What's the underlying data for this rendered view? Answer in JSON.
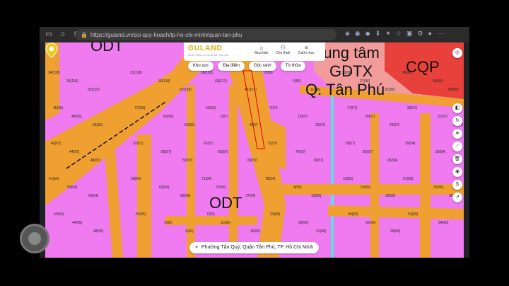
{
  "browser": {
    "url": "https://guland.vn/soi-quy-hoach/tp-ho-chi-minh/quan-tan-phu"
  },
  "header": {
    "logo": "GULAND",
    "logo_sub": "Kênh thông tin mua bán nhà đất",
    "nav": [
      {
        "icon": "house-icon",
        "label": "Mua bán"
      },
      {
        "icon": "people-icon",
        "label": "Cho thuê"
      },
      {
        "icon": "menu-icon",
        "label": "Danh mục"
      }
    ]
  },
  "chips": [
    "Khu vực",
    "Địa điểm",
    "Góc ranh",
    "Tờ thửa"
  ],
  "map_labels": {
    "odt_top": "ODT",
    "center_label_1": "rung tâm",
    "center_label_2": "GDTX",
    "center_label_3": "Q. Tân Phú",
    "cqp": "CQP",
    "odt_bottom": "ODT"
  },
  "address": "Phường Tân Quý, Quận Tân Phú, TP. Hồ Chí Minh",
  "lots": [
    "34(118)",
    "33(118)",
    "32(118)",
    "31(118)",
    "30(118)",
    "22(118)",
    "18(118)",
    "43(117)",
    "41(117)",
    "3(56)",
    "6(56)",
    "11(56)",
    "23(56)",
    "27(56)",
    "31(56)",
    "34(56)",
    "39(56)",
    "42(56)",
    "45(56)",
    "49(56)",
    "55(56)",
    "57(56)",
    "60(56)",
    "63(56)",
    "66(56)",
    "1(57)",
    "4(57)",
    "7(57)",
    "10(57)",
    "12(57)",
    "17(57)",
    "20(57)",
    "24(57)",
    "28(57)",
    "31(57)",
    "35(57)",
    "40(57)",
    "44(57)",
    "48(57)",
    "52(57)",
    "56(57)",
    "59(57)",
    "62(57)",
    "65(57)",
    "68(57)",
    "71(57)",
    "74(57)",
    "76(57)",
    "79(57)",
    "82(57)",
    "26(54)",
    "29(54)",
    "30(54)",
    "33(54)",
    "41(54)",
    "50(54)",
    "54(54)",
    "58(54)",
    "62(54)",
    "66(54)",
    "71(54)",
    "75(54)",
    "77(54)",
    "78(54)",
    "9(55)",
    "13(55)",
    "16(55)",
    "20(55)",
    "23(55)",
    "27(55)",
    "31(55)",
    "36(55)",
    "40(55)",
    "44(55)",
    "48(55)",
    "53(55)",
    "1(60)",
    "4(60)",
    "7(60)",
    "11(60)",
    "15(60)",
    "23(60)",
    "26(60)",
    "31(60)",
    "34(60)",
    "36(60)",
    "39(60)",
    "52(60)",
    "54(60)"
  ],
  "colors": {
    "residential": "#f07bf0",
    "road": "#f0a030",
    "public": "#f29b9b",
    "defense": "#e8403a",
    "river": "#60e0e0"
  },
  "rail": [
    "target-icon",
    "layers-icon",
    "refresh-icon",
    "navigate-icon",
    "ruler-icon",
    "trash-icon",
    "coin-icon",
    "dollar-icon",
    "share-icon"
  ]
}
